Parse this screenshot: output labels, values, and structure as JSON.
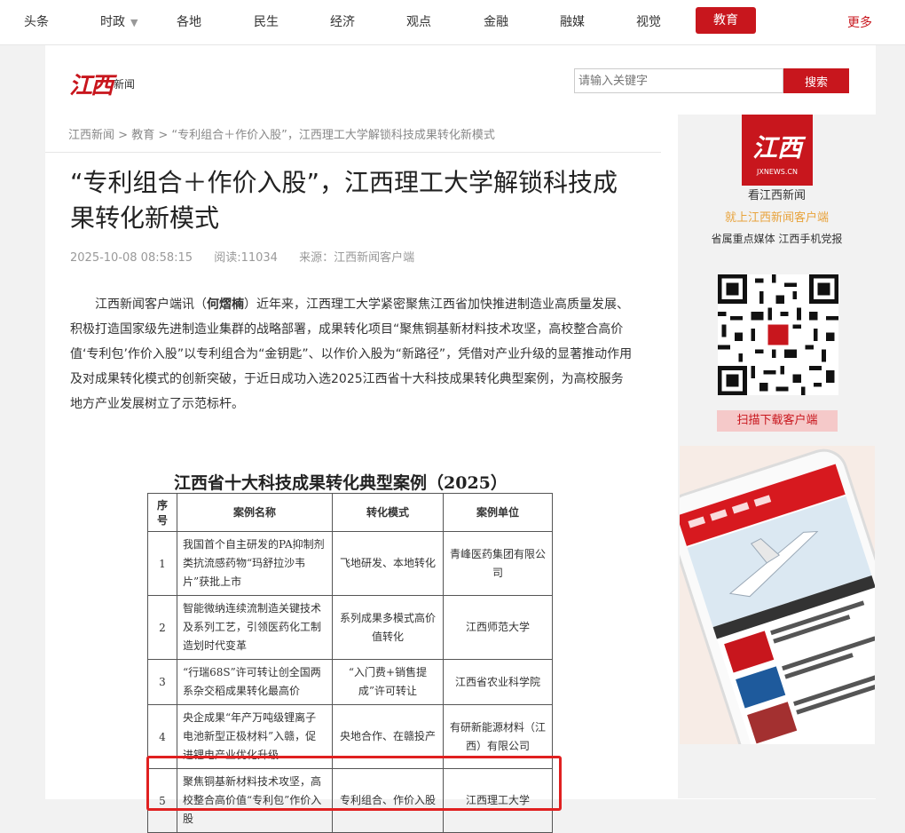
{
  "nav": {
    "items": [
      "头条",
      "时政",
      "各地",
      "民生",
      "经济",
      "观点",
      "金融",
      "融媒",
      "视觉",
      "教育"
    ],
    "more": "更多",
    "caret": "▼"
  },
  "header": {
    "logo": "江西",
    "logo_sub": "新闻",
    "search_placeholder": "请输入关键字",
    "search_button": "搜索"
  },
  "breadcrumb": [
    "江西新闻",
    "教育",
    "“专利组合＋作价入股”，江西理工大学解锁科技成果转化新模式"
  ],
  "breadcrumb_sep": " > ",
  "article": {
    "title": "“专利组合＋作价入股”，江西理工大学解锁科技成果转化新模式",
    "date": "2025-10-08 08:58:15",
    "reads": "阅读:11034",
    "source": "来源：江西新闻客户端",
    "body_prefix": "江西新闻客户端讯（",
    "body_author": "何熠楠",
    "body_text": "）近年来，江西理工大学紧密聚焦江西省加快推进制造业高质量发展、积极打造国家级先进制造业集群的战略部署，成果转化项目“聚焦铜基新材料技术攻坚，高校整合高价值‘专利包’作价入股”以专利组合为“金钥匙”、以作价入股为“新路径”，凭借对产业升级的显著推动作用及对成果转化模式的创新突破，于近日成功入选2025江西省十大科技成果转化典型案例，为高校服务地方产业发展树立了示范标杆。"
  },
  "embed": {
    "title": "江西省十大科技成果转化典型案例（2025）",
    "headers": [
      "序号",
      "案例名称",
      "转化模式",
      "案例单位"
    ],
    "rows": [
      [
        "1",
        "我国首个自主研发的PA抑制剂类抗流感药物“玛舒拉沙韦片”获批上市",
        "飞地研发、本地转化",
        "青峰医药集团有限公司"
      ],
      [
        "2",
        "智能微纳连续流制造关键技术及系列工艺，引领医药化工制造划时代变革",
        "系列成果多模式高价值转化",
        "江西师范大学"
      ],
      [
        "3",
        "“行瑞68S”许可转让创全国两系杂交稻成果转化最高价",
        "“入门费+销售提成”许可转让",
        "江西省农业科学院"
      ],
      [
        "4",
        "央企成果“年产万吨级锂离子电池新型正极材料”入赣，促进锂电产业优化升级",
        "央地合作、在赣投产",
        "有研新能源材料（江西）有限公司"
      ],
      [
        "5",
        "聚焦铜基新材料技术攻坚，高校整合高价值“专利包”作价入股",
        "专利组合、作价入股",
        "江西理工大学"
      ]
    ]
  },
  "sidebar": {
    "logo": "江西",
    "logo_sub": "JXNEWS.CN",
    "text1": "看江西新闻",
    "text2": "就上江西新闻客户端",
    "text3": "省属重点媒体 江西手机党报",
    "scan": "扫描下载客户端"
  },
  "colors": {
    "brand": "#c8161d",
    "accent": "#e8a33c"
  }
}
